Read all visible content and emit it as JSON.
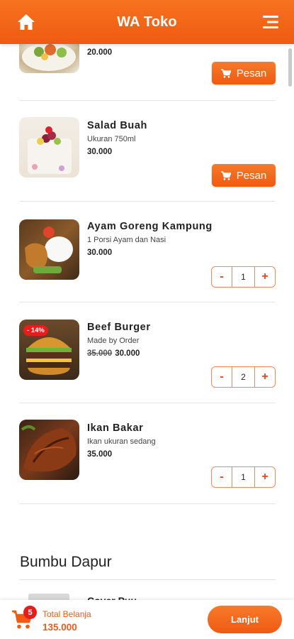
{
  "app": {
    "title": "WA Toko"
  },
  "header": {
    "home_icon": "home-icon",
    "menu_icon": "menu-icon"
  },
  "products": [
    {
      "name": "",
      "desc": "",
      "price": "20.000",
      "action": "order",
      "order_label": "Pesan"
    },
    {
      "name": "Salad Buah",
      "desc": "Ukuran 750ml",
      "price": "30.000",
      "action": "order",
      "order_label": "Pesan"
    },
    {
      "name": "Ayam Goreng Kampung",
      "desc": "1 Porsi Ayam dan Nasi",
      "price": "30.000",
      "action": "stepper",
      "qty": "1"
    },
    {
      "name": "Beef Burger",
      "desc": "Made by Order",
      "old_price": "35.000",
      "price": "30.000",
      "discount": "- 14%",
      "action": "stepper",
      "qty": "2"
    },
    {
      "name": "Ikan Bakar",
      "desc": "Ikan ukuran sedang",
      "price": "35.000",
      "action": "stepper",
      "qty": "1"
    }
  ],
  "stepper": {
    "minus": "-",
    "plus": "+"
  },
  "section": {
    "title": "Bumbu Dapur",
    "next_item_name": "Cover Puu"
  },
  "footer": {
    "cart_count": "5",
    "total_label": "Total Belanja",
    "total_value": "135.000",
    "next_label": "Lanjut"
  },
  "colors": {
    "accent": "#f05a12",
    "badge": "#e91c1c"
  }
}
